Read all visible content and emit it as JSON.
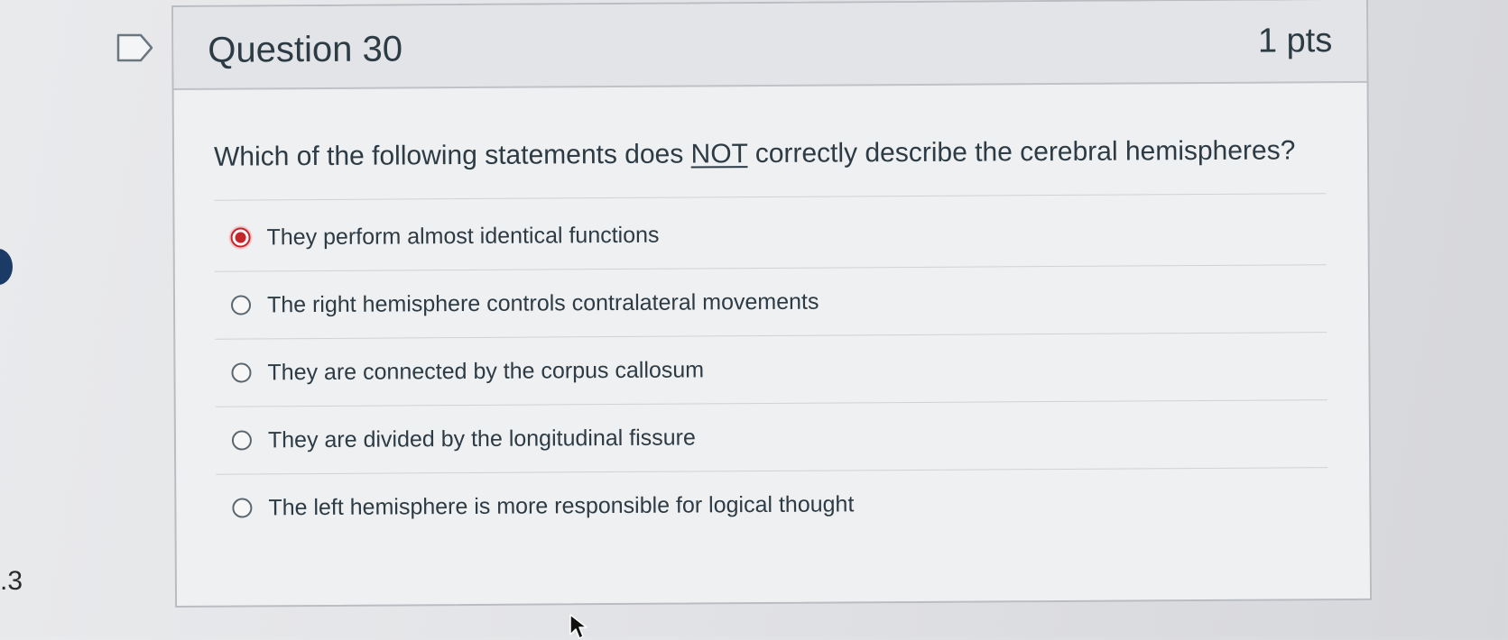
{
  "question": {
    "title": "Question 30",
    "points": "1 pts",
    "text_before": "Which of the following statements does ",
    "text_emphasis": "NOT",
    "text_after": " correctly describe the cerebral hemispheres?"
  },
  "answers": [
    {
      "label": "They perform almost identical functions",
      "selected": true
    },
    {
      "label": "The right hemisphere controls contralateral movements",
      "selected": false
    },
    {
      "label": "They are connected by the corpus callosum",
      "selected": false
    },
    {
      "label": "They are divided by the longitudinal fissure",
      "selected": false
    },
    {
      "label": "The left hemisphere is more responsible for logical thought",
      "selected": false
    }
  ],
  "sidebar": {
    "number_fragment": ".3"
  },
  "icons": {
    "flag": "flag-icon",
    "cursor": "mouse-cursor-icon"
  },
  "colors": {
    "selected_radio": "#c5262b",
    "text": "#2d3b45"
  }
}
